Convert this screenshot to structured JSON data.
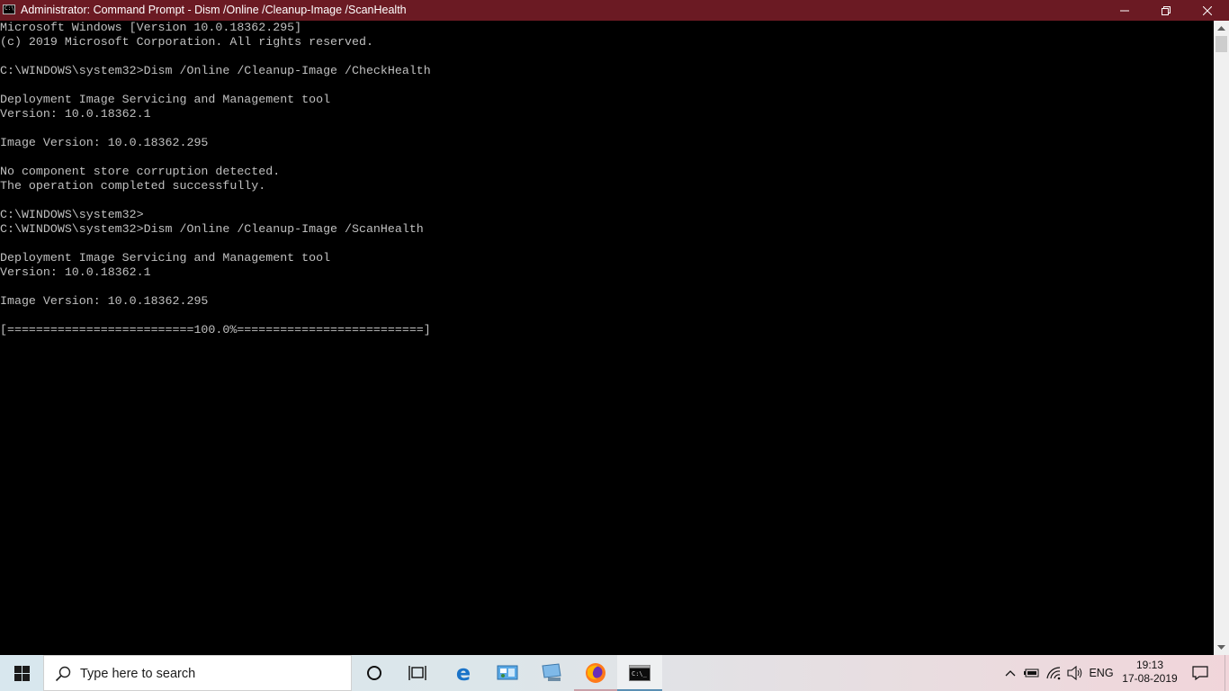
{
  "window": {
    "title": "Administrator: Command Prompt - Dism  /Online /Cleanup-Image /ScanHealth",
    "icon_name": "cmd-icon",
    "titlebar_color": "#6b1a23"
  },
  "console": {
    "lines": [
      "Microsoft Windows [Version 10.0.18362.295]",
      "(c) 2019 Microsoft Corporation. All rights reserved.",
      "",
      "C:\\WINDOWS\\system32>Dism /Online /Cleanup-Image /CheckHealth",
      "",
      "Deployment Image Servicing and Management tool",
      "Version: 10.0.18362.1",
      "",
      "Image Version: 10.0.18362.295",
      "",
      "No component store corruption detected.",
      "The operation completed successfully.",
      "",
      "C:\\WINDOWS\\system32>",
      "C:\\WINDOWS\\system32>Dism /Online /Cleanup-Image /ScanHealth",
      "",
      "Deployment Image Servicing and Management tool",
      "Version: 10.0.18362.1",
      "",
      "Image Version: 10.0.18362.295",
      "",
      "[==========================100.0%==========================]"
    ],
    "text_color": "#c0c0c0",
    "background": "#000000"
  },
  "taskbar": {
    "search_placeholder": "Type here to search",
    "pinned": [
      "cortana-icon",
      "task-view-icon",
      "edge-icon",
      "control-panel-icon",
      "network-computer-icon",
      "firefox-icon",
      "cmd-icon"
    ],
    "tray": {
      "language": "ENG",
      "time": "19:13",
      "date": "17-08-2019"
    }
  }
}
